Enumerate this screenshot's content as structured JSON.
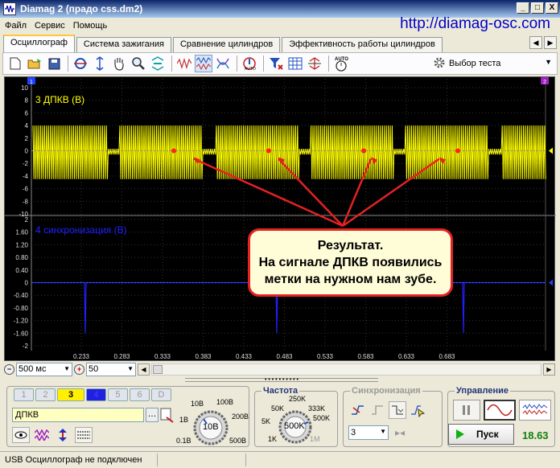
{
  "window": {
    "title": "Diamag 2 (прадо css.dm2)",
    "buttons": [
      "_",
      "□",
      "X"
    ]
  },
  "menu": [
    "Файл",
    "Сервис",
    "Помощь"
  ],
  "site_url": "http://diamag-osc.com",
  "tabs": [
    "Осциллограф",
    "Система зажигания",
    "Сравнение цилиндров",
    "Эффективность работы цилиндров"
  ],
  "toolbar": {
    "test_select_label": "Выбор теста"
  },
  "scope": {
    "channel_top": {
      "label": "3 ДПКВ (В)",
      "color": "#ffff00",
      "y_ticks": [
        "10",
        "8",
        "6",
        "4",
        "2",
        "0",
        "-2",
        "-4",
        "-6",
        "-8",
        "-10"
      ]
    },
    "channel_bottom": {
      "label": "4 синхронизация (В)",
      "color": "#2020ff",
      "y_ticks": [
        "2",
        "1.60",
        "1.20",
        "0.80",
        "0.40",
        "0",
        "-0.40",
        "-0.80",
        "-1.20",
        "-1.60",
        "-2"
      ]
    },
    "x_ticks": [
      "0.233",
      "0.283",
      "0.333",
      "0.383",
      "0.433",
      "0.483",
      "0.533",
      "0.583",
      "0.633",
      "0.683"
    ],
    "marker_left": "1",
    "marker_right": "2"
  },
  "callout": {
    "lines": [
      "Результат.",
      "На сигнале ДПКВ появились",
      "метки на нужном нам зубе."
    ]
  },
  "bottom_bar": {
    "timebase": "500 мс",
    "zoom": "50"
  },
  "channels": {
    "buttons": [
      "1",
      "2",
      "3",
      "4",
      "5",
      "6",
      "D"
    ],
    "name_value": "ДПКВ",
    "range_labels": [
      "10В",
      "100В",
      "1В",
      "200В",
      "0.1В",
      "500В"
    ],
    "range_value": "10В"
  },
  "frequency": {
    "title": "Частота",
    "labels": [
      "250K",
      "50K",
      "333K",
      "5K",
      "500K",
      "1K",
      "1M"
    ],
    "value": "500K"
  },
  "sync": {
    "title": "Синхронизация",
    "channel": "3"
  },
  "control": {
    "title": "Управление",
    "start_label": "Пуск",
    "fps": "18.63"
  },
  "status": {
    "text": "USB Осциллограф не подключен"
  }
}
